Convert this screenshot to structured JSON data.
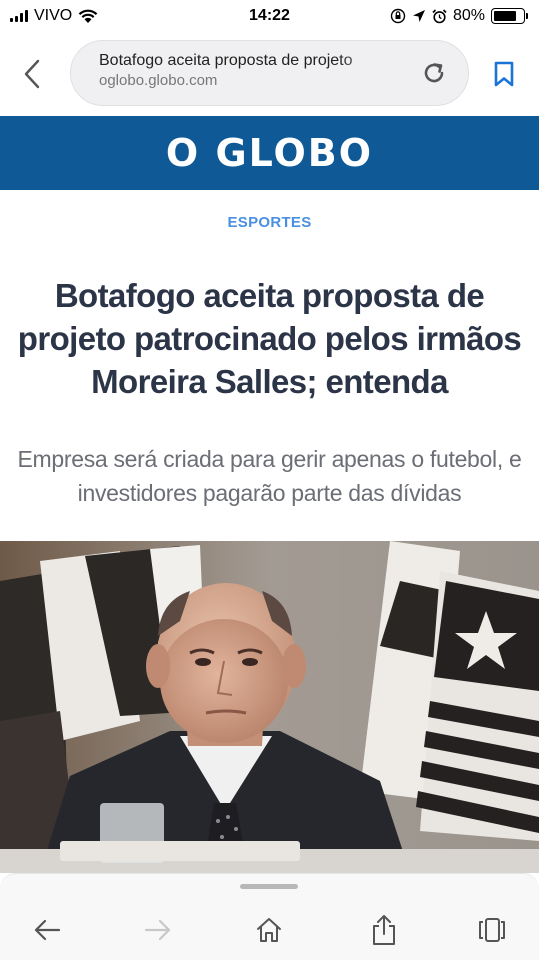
{
  "status_bar": {
    "carrier": "VIVO",
    "time": "14:22",
    "battery_percent": "80%",
    "battery_level": 0.8,
    "icons": [
      "signal-icon",
      "wifi-icon",
      "orientation-lock-icon",
      "location-icon",
      "alarm-icon",
      "battery-icon"
    ]
  },
  "browser": {
    "page_title": "Botafogo aceita proposta de projeto",
    "host": "oglobo.globo.com",
    "icons": [
      "back-icon",
      "reload-icon",
      "bookmark-icon"
    ]
  },
  "masthead": {
    "logo_text": "O GLOBO",
    "color": "#0f5a96"
  },
  "article": {
    "section": "ESPORTES",
    "headline": "Botafogo aceita proposta de projeto patrocinado pelos irmãos Moreira Salles; entenda",
    "subheadline": "Empresa será criada para gerir apenas o futebol, e investidores pagarão parte das dívidas",
    "section_color": "#4a90e2"
  },
  "toolbar": {
    "icons": [
      "back-arrow-icon",
      "forward-arrow-icon",
      "home-icon",
      "share-icon",
      "tabs-icon"
    ]
  }
}
